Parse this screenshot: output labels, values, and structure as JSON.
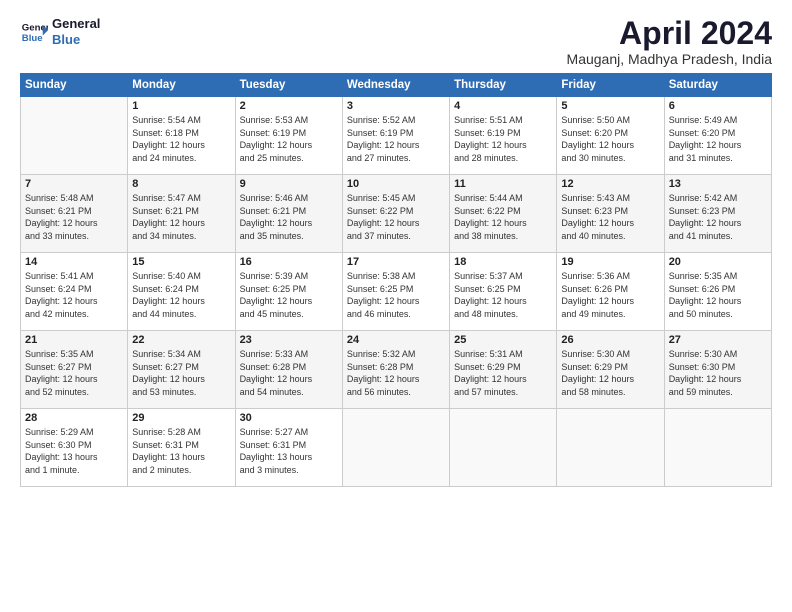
{
  "header": {
    "logo_line1": "General",
    "logo_line2": "Blue",
    "title": "April 2024",
    "subtitle": "Mauganj, Madhya Pradesh, India"
  },
  "days_of_week": [
    "Sunday",
    "Monday",
    "Tuesday",
    "Wednesday",
    "Thursday",
    "Friday",
    "Saturday"
  ],
  "weeks": [
    [
      {
        "day": "",
        "info": ""
      },
      {
        "day": "1",
        "info": "Sunrise: 5:54 AM\nSunset: 6:18 PM\nDaylight: 12 hours\nand 24 minutes."
      },
      {
        "day": "2",
        "info": "Sunrise: 5:53 AM\nSunset: 6:19 PM\nDaylight: 12 hours\nand 25 minutes."
      },
      {
        "day": "3",
        "info": "Sunrise: 5:52 AM\nSunset: 6:19 PM\nDaylight: 12 hours\nand 27 minutes."
      },
      {
        "day": "4",
        "info": "Sunrise: 5:51 AM\nSunset: 6:19 PM\nDaylight: 12 hours\nand 28 minutes."
      },
      {
        "day": "5",
        "info": "Sunrise: 5:50 AM\nSunset: 6:20 PM\nDaylight: 12 hours\nand 30 minutes."
      },
      {
        "day": "6",
        "info": "Sunrise: 5:49 AM\nSunset: 6:20 PM\nDaylight: 12 hours\nand 31 minutes."
      }
    ],
    [
      {
        "day": "7",
        "info": "Sunrise: 5:48 AM\nSunset: 6:21 PM\nDaylight: 12 hours\nand 33 minutes."
      },
      {
        "day": "8",
        "info": "Sunrise: 5:47 AM\nSunset: 6:21 PM\nDaylight: 12 hours\nand 34 minutes."
      },
      {
        "day": "9",
        "info": "Sunrise: 5:46 AM\nSunset: 6:21 PM\nDaylight: 12 hours\nand 35 minutes."
      },
      {
        "day": "10",
        "info": "Sunrise: 5:45 AM\nSunset: 6:22 PM\nDaylight: 12 hours\nand 37 minutes."
      },
      {
        "day": "11",
        "info": "Sunrise: 5:44 AM\nSunset: 6:22 PM\nDaylight: 12 hours\nand 38 minutes."
      },
      {
        "day": "12",
        "info": "Sunrise: 5:43 AM\nSunset: 6:23 PM\nDaylight: 12 hours\nand 40 minutes."
      },
      {
        "day": "13",
        "info": "Sunrise: 5:42 AM\nSunset: 6:23 PM\nDaylight: 12 hours\nand 41 minutes."
      }
    ],
    [
      {
        "day": "14",
        "info": "Sunrise: 5:41 AM\nSunset: 6:24 PM\nDaylight: 12 hours\nand 42 minutes."
      },
      {
        "day": "15",
        "info": "Sunrise: 5:40 AM\nSunset: 6:24 PM\nDaylight: 12 hours\nand 44 minutes."
      },
      {
        "day": "16",
        "info": "Sunrise: 5:39 AM\nSunset: 6:25 PM\nDaylight: 12 hours\nand 45 minutes."
      },
      {
        "day": "17",
        "info": "Sunrise: 5:38 AM\nSunset: 6:25 PM\nDaylight: 12 hours\nand 46 minutes."
      },
      {
        "day": "18",
        "info": "Sunrise: 5:37 AM\nSunset: 6:25 PM\nDaylight: 12 hours\nand 48 minutes."
      },
      {
        "day": "19",
        "info": "Sunrise: 5:36 AM\nSunset: 6:26 PM\nDaylight: 12 hours\nand 49 minutes."
      },
      {
        "day": "20",
        "info": "Sunrise: 5:35 AM\nSunset: 6:26 PM\nDaylight: 12 hours\nand 50 minutes."
      }
    ],
    [
      {
        "day": "21",
        "info": "Sunrise: 5:35 AM\nSunset: 6:27 PM\nDaylight: 12 hours\nand 52 minutes."
      },
      {
        "day": "22",
        "info": "Sunrise: 5:34 AM\nSunset: 6:27 PM\nDaylight: 12 hours\nand 53 minutes."
      },
      {
        "day": "23",
        "info": "Sunrise: 5:33 AM\nSunset: 6:28 PM\nDaylight: 12 hours\nand 54 minutes."
      },
      {
        "day": "24",
        "info": "Sunrise: 5:32 AM\nSunset: 6:28 PM\nDaylight: 12 hours\nand 56 minutes."
      },
      {
        "day": "25",
        "info": "Sunrise: 5:31 AM\nSunset: 6:29 PM\nDaylight: 12 hours\nand 57 minutes."
      },
      {
        "day": "26",
        "info": "Sunrise: 5:30 AM\nSunset: 6:29 PM\nDaylight: 12 hours\nand 58 minutes."
      },
      {
        "day": "27",
        "info": "Sunrise: 5:30 AM\nSunset: 6:30 PM\nDaylight: 12 hours\nand 59 minutes."
      }
    ],
    [
      {
        "day": "28",
        "info": "Sunrise: 5:29 AM\nSunset: 6:30 PM\nDaylight: 13 hours\nand 1 minute."
      },
      {
        "day": "29",
        "info": "Sunrise: 5:28 AM\nSunset: 6:31 PM\nDaylight: 13 hours\nand 2 minutes."
      },
      {
        "day": "30",
        "info": "Sunrise: 5:27 AM\nSunset: 6:31 PM\nDaylight: 13 hours\nand 3 minutes."
      },
      {
        "day": "",
        "info": ""
      },
      {
        "day": "",
        "info": ""
      },
      {
        "day": "",
        "info": ""
      },
      {
        "day": "",
        "info": ""
      }
    ]
  ]
}
